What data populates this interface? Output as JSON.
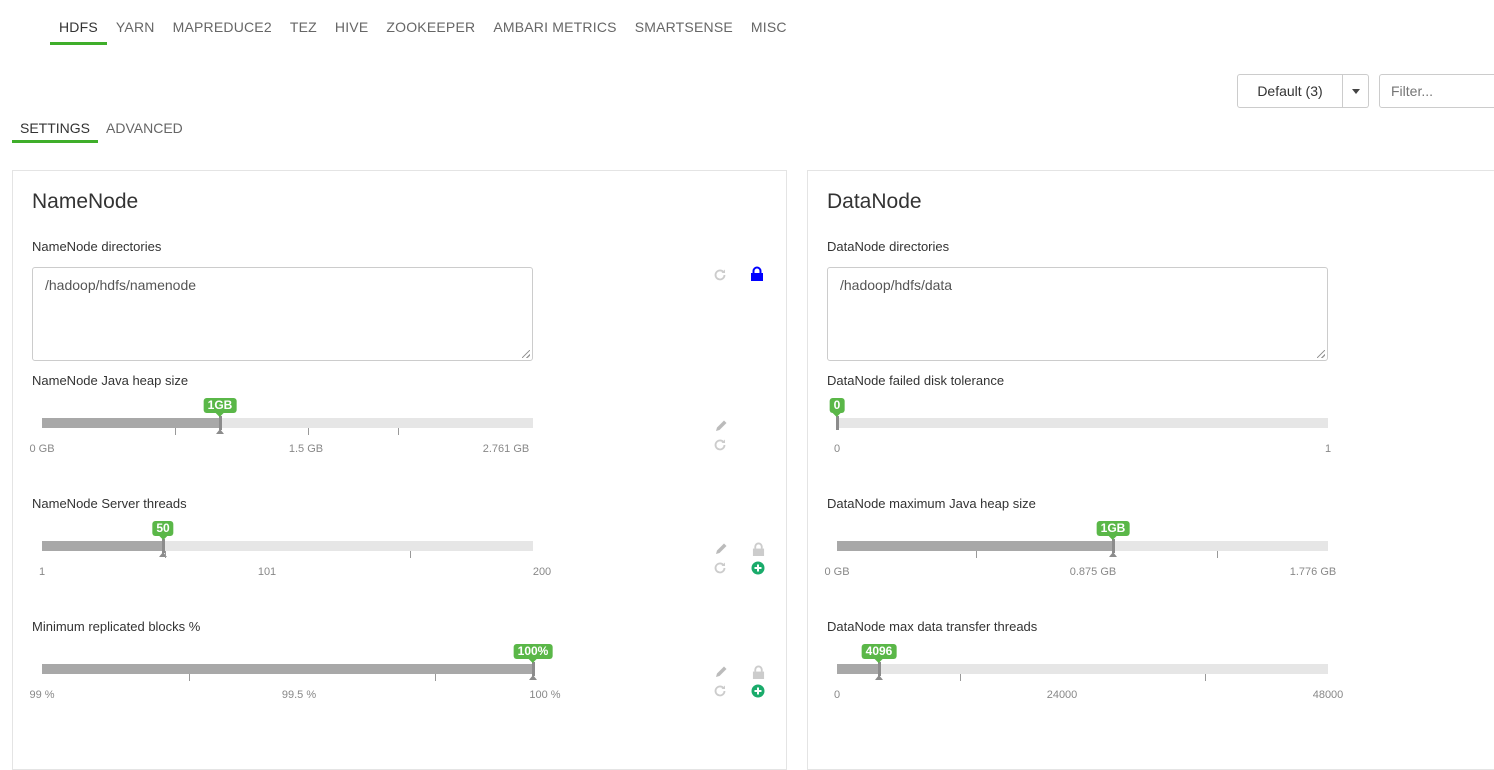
{
  "service_tabs": [
    "HDFS",
    "YARN",
    "MAPREDUCE2",
    "TEZ",
    "HIVE",
    "ZOOKEEPER",
    "AMBARI METRICS",
    "SMARTSENSE",
    "MISC"
  ],
  "active_service": "HDFS",
  "config_group": {
    "label": "Default (3)"
  },
  "filter": {
    "placeholder": "Filter..."
  },
  "sub_tabs": [
    "SETTINGS",
    "ADVANCED"
  ],
  "active_sub_tab": "SETTINGS",
  "colors": {
    "accent": "#3fae2a",
    "badge": "#5ab748",
    "lock_blue": "#0000ff",
    "add_green": "#1aab6b"
  },
  "namenode": {
    "title": "NameNode",
    "dir_label": "NameNode directories",
    "dir_value": "/hadoop/hdfs/namenode",
    "heap": {
      "label": "NameNode Java heap size",
      "value_label": "1GB",
      "fraction": 0.362,
      "ticks": [
        "0 GB",
        "1.5 GB",
        "2.761 GB"
      ]
    },
    "threads": {
      "label": "NameNode Server threads",
      "value_label": "50",
      "fraction": 0.246,
      "ticks": [
        "1",
        "101",
        "200"
      ]
    },
    "min_blocks": {
      "label": "Minimum replicated blocks %",
      "value_label": "100%",
      "fraction": 1.0,
      "ticks": [
        "99 %",
        "99.5 %",
        "100 %"
      ]
    }
  },
  "datanode": {
    "title": "DataNode",
    "dir_label": "DataNode directories",
    "dir_value": "/hadoop/hdfs/data",
    "disk_tolerance": {
      "label": "DataNode failed disk tolerance",
      "value_label": "0",
      "fraction": 0.0,
      "ticks": [
        "0",
        "1"
      ]
    },
    "max_heap": {
      "label": "DataNode maximum Java heap size",
      "value_label": "1GB",
      "fraction": 0.563,
      "ticks": [
        "0 GB",
        "0.875 GB",
        "1.776 GB"
      ]
    },
    "transfer_threads": {
      "label": "DataNode max data transfer threads",
      "value_label": "4096",
      "fraction": 0.085,
      "ticks": [
        "0",
        "24000",
        "48000"
      ]
    }
  }
}
